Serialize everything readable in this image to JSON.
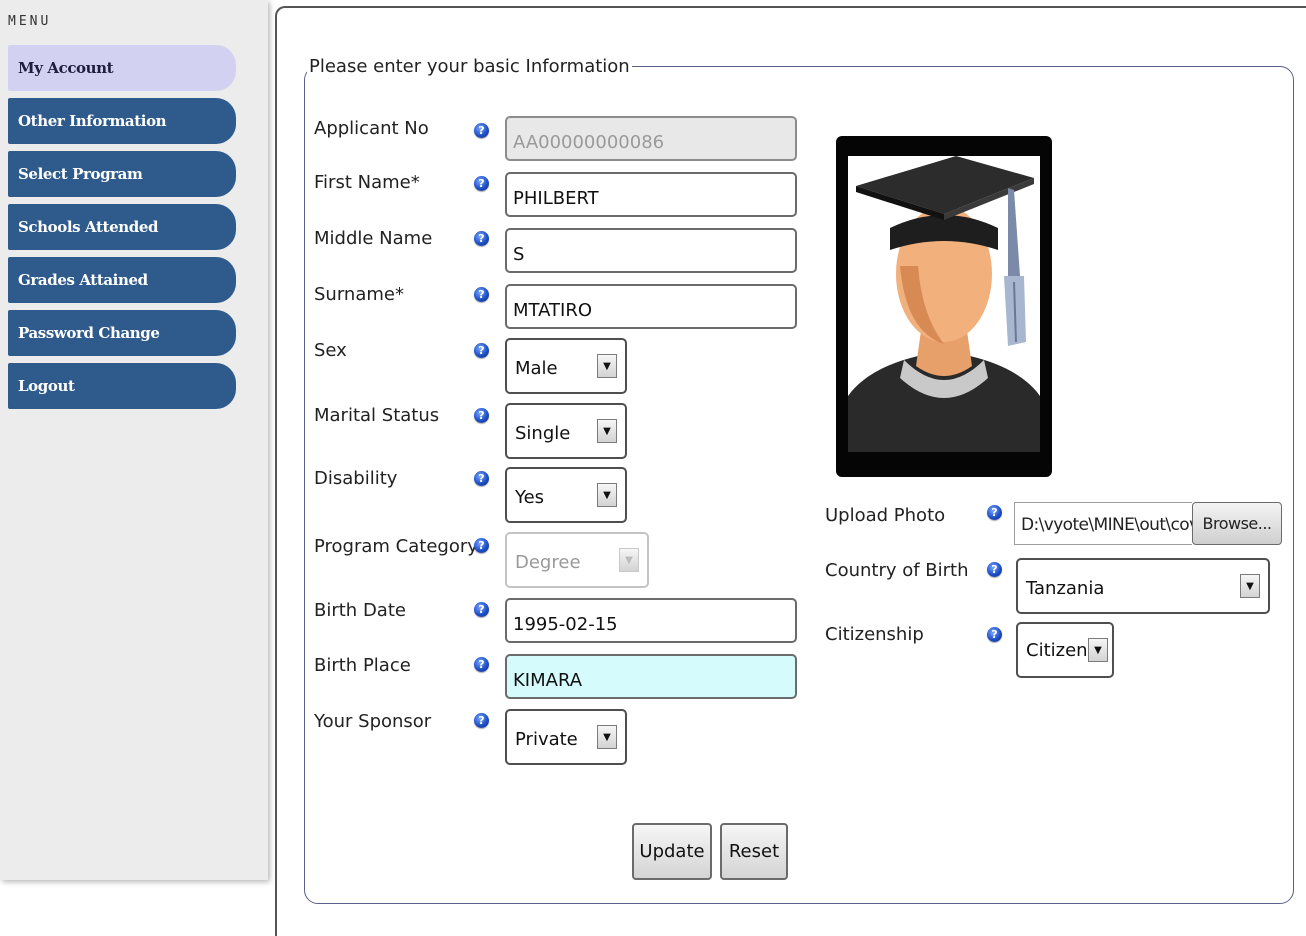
{
  "sidebar": {
    "title": "MENU",
    "items": [
      {
        "label": "My Account",
        "active": true
      },
      {
        "label": "Other Information",
        "active": false
      },
      {
        "label": "Select Program",
        "active": false
      },
      {
        "label": "Schools Attended",
        "active": false
      },
      {
        "label": "Grades Attained",
        "active": false
      },
      {
        "label": "Password Change",
        "active": false
      },
      {
        "label": "Logout",
        "active": false
      }
    ]
  },
  "form": {
    "legend": "Please enter your basic Information",
    "fields": {
      "applicant_no": {
        "label": "Applicant No",
        "value": "AA00000000086"
      },
      "first_name": {
        "label": "First Name*",
        "value": "PHILBERT"
      },
      "middle_name": {
        "label": "Middle Name",
        "value": "S"
      },
      "surname": {
        "label": "Surname*",
        "value": "MTATIRO"
      },
      "sex": {
        "label": "Sex",
        "value": "Male"
      },
      "marital_status": {
        "label": "Marital Status",
        "value": "Single"
      },
      "disability": {
        "label": "Disability",
        "value": "Yes"
      },
      "program_category": {
        "label": "Program Category",
        "value": "Degree"
      },
      "birth_date": {
        "label": "Birth Date",
        "value": "1995-02-15"
      },
      "birth_place": {
        "label": "Birth Place",
        "value": "KIMARA"
      },
      "sponsor": {
        "label": "Your Sponsor",
        "value": "Private"
      },
      "upload_photo": {
        "label": "Upload Photo",
        "value": "D:\\vyote\\MINE\\out\\cove",
        "browse_label": "Browse..."
      },
      "country_of_birth": {
        "label": "Country of Birth",
        "value": "Tanzania"
      },
      "citizenship": {
        "label": "Citizenship",
        "value": "Citizen"
      }
    },
    "help_glyph": "?",
    "dropdown_glyph": "▼",
    "buttons": {
      "update": "Update",
      "reset": "Reset"
    }
  },
  "colors": {
    "nav_bg": "#2f5b8c",
    "nav_active_bg": "#d3d1f1",
    "birth_place_bg": "#d5fbfd",
    "help_icon": "#1f4fc8"
  }
}
